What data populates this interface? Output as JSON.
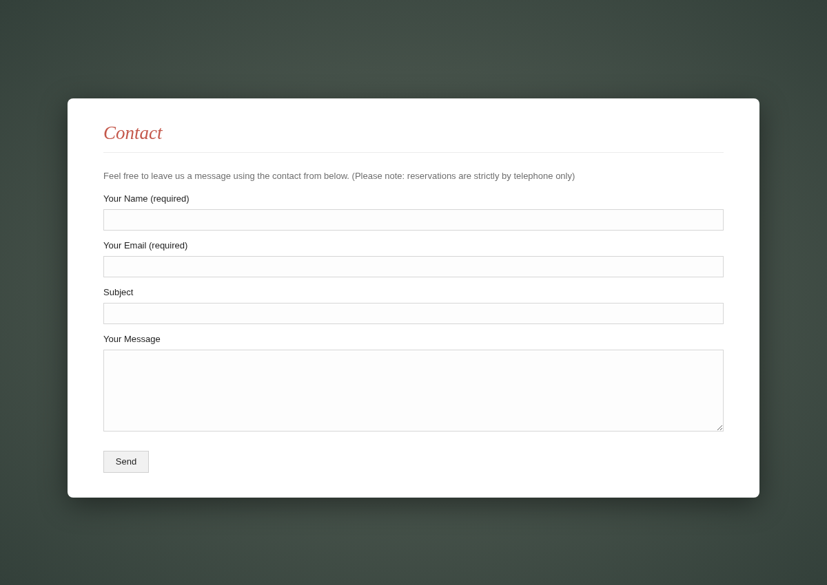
{
  "title": "Contact",
  "intro": "Feel free to leave us a message using the contact from below. (Please note: reservations are strictly by telephone only)",
  "fields": [
    {
      "kind": "input",
      "label": "Your Name (required)"
    },
    {
      "kind": "input",
      "label": "Your Email (required)"
    },
    {
      "kind": "input",
      "label": "Subject"
    },
    {
      "kind": "textarea",
      "label": "Your Message"
    }
  ],
  "submit": "Send"
}
